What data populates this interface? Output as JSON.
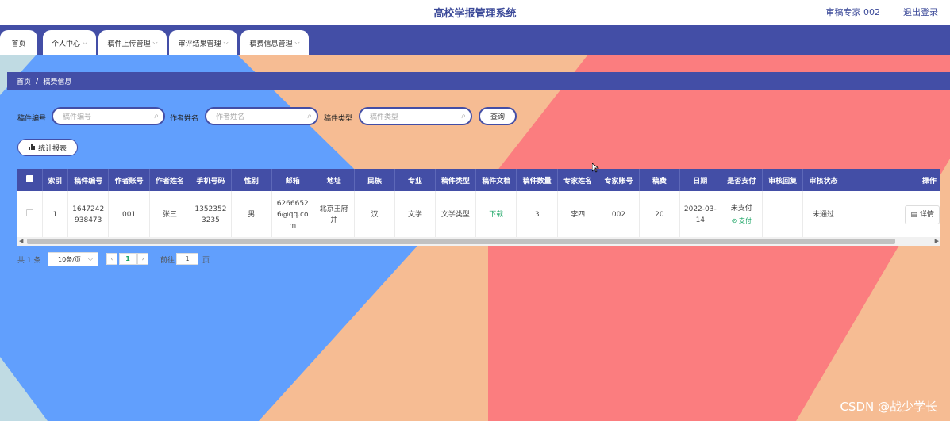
{
  "header": {
    "title": "高校学报管理系统",
    "user": "审稿专家 002",
    "logout": "退出登录"
  },
  "nav": {
    "items": [
      {
        "label": "首页"
      },
      {
        "label": "个人中心"
      },
      {
        "label": "稿件上传管理"
      },
      {
        "label": "审评结果管理"
      },
      {
        "label": "稿费信息管理"
      }
    ]
  },
  "breadcrumb": {
    "home": "首页",
    "separator": "/",
    "current": "稿费信息"
  },
  "search": {
    "manuscript_no_label": "稿件编号",
    "manuscript_no_placeholder": "稿件编号",
    "author_name_label": "作者姓名",
    "author_name_placeholder": "作者姓名",
    "manuscript_type_label": "稿件类型",
    "manuscript_type_placeholder": "稿件类型",
    "query_label": "查询"
  },
  "stats_button": "统计报表",
  "table": {
    "headers": [
      "索引",
      "稿件编号",
      "作者账号",
      "作者姓名",
      "手机号码",
      "性别",
      "邮箱",
      "地址",
      "民族",
      "专业",
      "稿件类型",
      "稿件文档",
      "稿件数量",
      "专家姓名",
      "专家账号",
      "稿费",
      "日期",
      "是否支付",
      "审核回复",
      "审核状态",
      "操作"
    ],
    "rows": [
      {
        "index": "1",
        "manuscript_no": "1647242938473",
        "author_account": "001",
        "author_name": "张三",
        "phone": "13523523235",
        "gender": "男",
        "email": "62666526@qq.com",
        "address": "北京王府井",
        "ethnicity": "汉",
        "major": "文学",
        "manuscript_type": "文学类型",
        "document": "下载",
        "count": "3",
        "expert_name": "李四",
        "expert_account": "002",
        "fee": "20",
        "date": "2022-03-14",
        "pay_status": "未支付",
        "pay_action": "支付",
        "review_reply": "",
        "review_status": "未通过",
        "action": "详情"
      }
    ]
  },
  "pagination": {
    "total": "共 1 条",
    "page_size": "10条/页",
    "current_page": "1",
    "goto_label": "前往",
    "goto_value": "1",
    "page_unit": "页"
  },
  "watermark": "CSDN @战少学长",
  "colors": {
    "primary": "#434ea6",
    "blue_bg": "#619ffd",
    "salmon": "#fb7d7f",
    "peach": "#f6bc93",
    "light_blue": "#c0dbe3",
    "green": "#19a463"
  }
}
